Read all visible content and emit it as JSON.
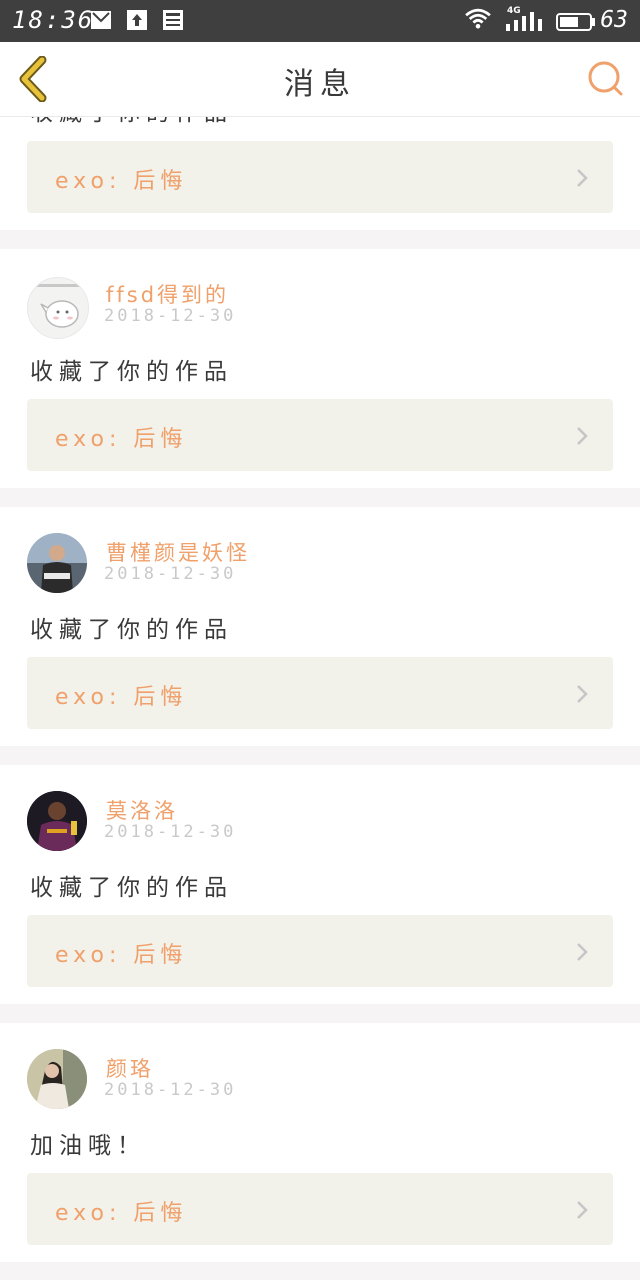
{
  "status_bar": {
    "time": "18:36",
    "network": "4G",
    "battery": "63"
  },
  "header": {
    "title": "消息"
  },
  "partial_top": {
    "message": "收藏了你的作品",
    "work_label": "exo: 后悔"
  },
  "notifications": [
    {
      "username": "ffsd得到的",
      "date": "2018-12-30",
      "message": "收藏了你的作品",
      "work_label": "exo: 后悔"
    },
    {
      "username": "曹槿颜是妖怪",
      "date": "2018-12-30",
      "message": "收藏了你的作品",
      "work_label": "exo: 后悔"
    },
    {
      "username": "莫洛洛",
      "date": "2018-12-30",
      "message": "收藏了你的作品",
      "work_label": "exo: 后悔"
    },
    {
      "username": "颜珞",
      "date": "2018-12-30",
      "message": "加油哦！",
      "work_label": "exo: 后悔"
    }
  ],
  "colors": {
    "accent": "#f0a06a",
    "status_bar": "#3f3f3f",
    "back_arrow": "#e8c23a",
    "work_row_bg": "#f2f1ea"
  }
}
